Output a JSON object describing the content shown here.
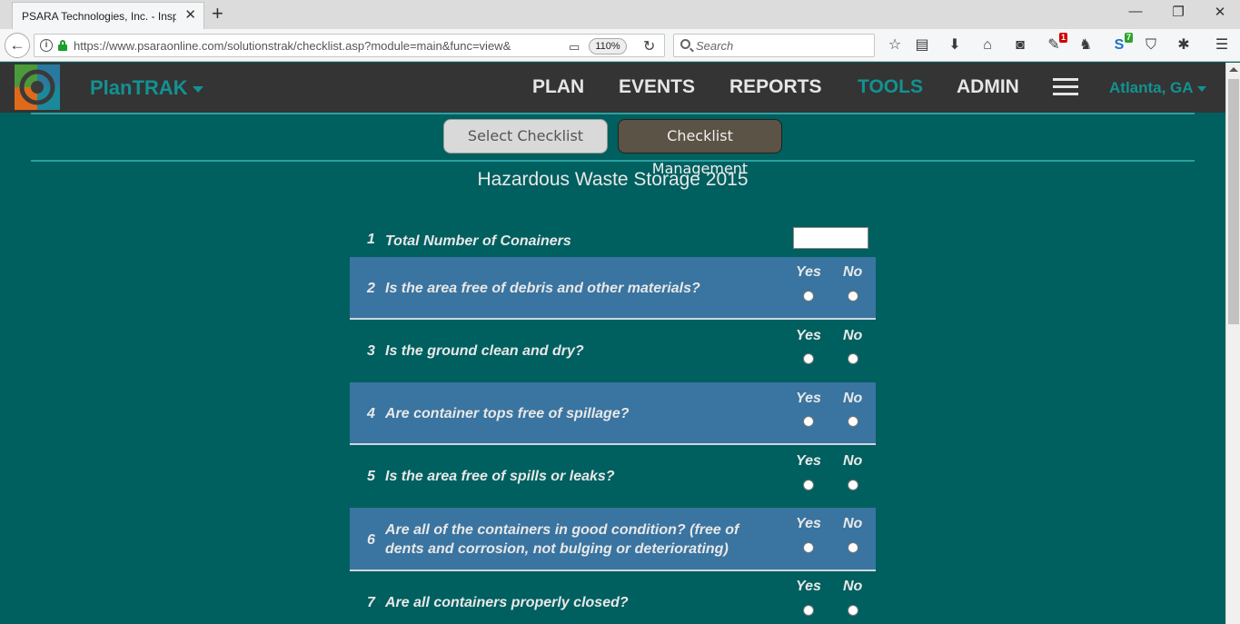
{
  "browser": {
    "tab_title": "PSARA Technologies, Inc. - Inspections",
    "url": "https://www.psaraonline.com/solutionstrak/checklist.asp?module=main&func=view&",
    "zoom": "110%",
    "search_placeholder": "Search",
    "badge_red": "1",
    "badge_green": "7"
  },
  "app": {
    "brand": "PlanTRAK",
    "nav": [
      "PLAN",
      "EVENTS",
      "REPORTS",
      "TOOLS",
      "ADMIN"
    ],
    "active_nav": "TOOLS",
    "location": "Atlanta, GA"
  },
  "buttons": {
    "select_checklist": "Select Checklist",
    "checklist_management": "Checklist Management"
  },
  "checklist": {
    "title": "Hazardous Waste Storage 2015",
    "yes_label": "Yes",
    "no_label": "No",
    "questions": [
      {
        "num": "1",
        "text": "Total Number of Conainers",
        "type": "number"
      },
      {
        "num": "2",
        "text": "Is the area free of debris and other materials?",
        "type": "yesno"
      },
      {
        "num": "3",
        "text": "Is the ground clean and dry?",
        "type": "yesno"
      },
      {
        "num": "4",
        "text": "Are container tops free of spillage?",
        "type": "yesno"
      },
      {
        "num": "5",
        "text": "Is the area free of spills or leaks?",
        "type": "yesno"
      },
      {
        "num": "6",
        "text": "Are all of the containers in good condition? (free of dents and corrosion, not bulging or deteriorating)",
        "type": "yesno"
      },
      {
        "num": "7",
        "text": "Are all containers properly closed?",
        "type": "yesno"
      }
    ]
  },
  "colors": {
    "page_bg": "#005f5f",
    "header_bg": "#343434",
    "accent_teal": "#129292",
    "row_blue": "#3a74a0"
  }
}
